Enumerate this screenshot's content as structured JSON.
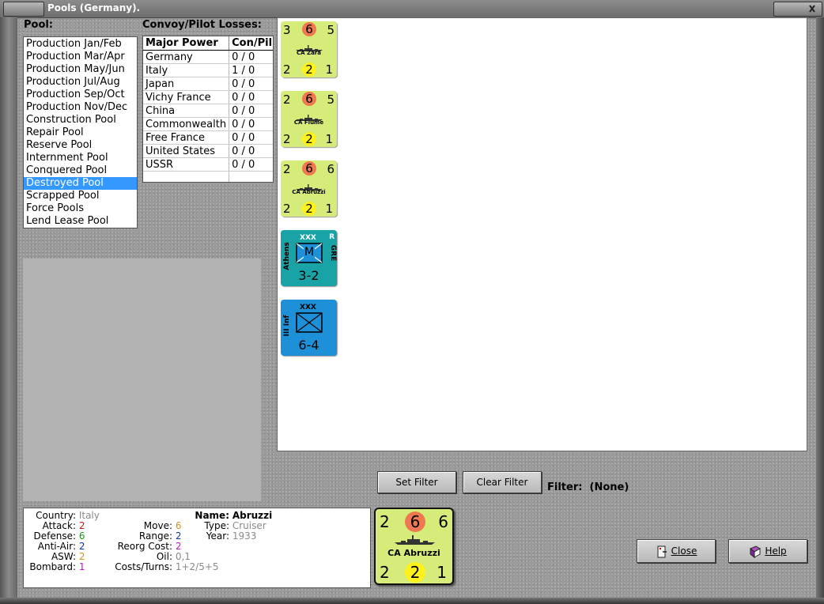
{
  "window": {
    "title": "Pools (Germany)."
  },
  "pool": {
    "heading": "Pool:",
    "items": [
      "Production Jan/Feb",
      "Production Mar/Apr",
      "Production May/Jun",
      "Production Jul/Aug",
      "Production Sep/Oct",
      "Production Nov/Dec",
      "Construction Pool",
      "Repair Pool",
      "Reserve Pool",
      "Internment Pool",
      "Conquered Pool",
      "Destroyed Pool",
      "Scrapped Pool",
      "Force Pools",
      "Lend Lease Pool"
    ],
    "selected": "Destroyed Pool"
  },
  "losses": {
    "heading": "Convoy/Pilot Losses:",
    "col_power": "Major Power",
    "col_value": "Con/Pil",
    "rows": [
      {
        "power": "Germany",
        "value": "0 / 0"
      },
      {
        "power": "Italy",
        "value": "1 / 0"
      },
      {
        "power": "Japan",
        "value": "0 / 0"
      },
      {
        "power": "Vichy France",
        "value": "0 / 0"
      },
      {
        "power": "China",
        "value": "0 / 0"
      },
      {
        "power": "Commonwealth",
        "value": "0 / 0"
      },
      {
        "power": "Free France",
        "value": "0 / 0"
      },
      {
        "power": "United States",
        "value": "0 / 0"
      },
      {
        "power": "USSR",
        "value": "0 / 0"
      }
    ]
  },
  "counters": [
    {
      "kind": "ship",
      "name": "CA Zara",
      "tl": "3",
      "tc": "6",
      "tr": "5",
      "bl": "2",
      "bc": "2",
      "br": "1"
    },
    {
      "kind": "ship",
      "name": "CA Fiume",
      "tl": "2",
      "tc": "6",
      "tr": "5",
      "bl": "2",
      "bc": "2",
      "br": "1"
    },
    {
      "kind": "ship",
      "name": "CA Abruzzi",
      "tl": "2",
      "tc": "6",
      "tr": "6",
      "bl": "2",
      "bc": "2",
      "br": "1"
    },
    {
      "kind": "land-mech",
      "side": "Athens",
      "size": "XXX",
      "corner": "R",
      "nation": "GRE",
      "symbol": "M",
      "strength": "3-2"
    },
    {
      "kind": "land-inf",
      "side": "III Inf",
      "size": "XXX",
      "strength": "6-4"
    }
  ],
  "filter": {
    "set_label": "Set Filter",
    "clear_label": "Clear Filter",
    "label": "Filter:",
    "value": "(None)"
  },
  "info": {
    "country_label": "Country:",
    "country": "Italy",
    "attack_label": "Attack:",
    "attack": "2",
    "defense_label": "Defense:",
    "defense": "6",
    "antiair_label": "Anti-Air:",
    "antiair": "2",
    "asw_label": "ASW:",
    "asw": "2",
    "bombard_label": "Bombard:",
    "bombard": "1",
    "move_label": "Move:",
    "move": "6",
    "range_label": "Range:",
    "range": "2",
    "reorg_label": "Reorg Cost:",
    "reorg": "2",
    "oil_label": "Oil:",
    "oil": "0,1",
    "costs_label": "Costs/Turns:",
    "costs": "1+2/5+5",
    "name_label": "Name:",
    "name": "Abruzzi",
    "type_label": "Type:",
    "type": "Cruiser",
    "year_label": "Year:",
    "year": "1933"
  },
  "selected_counter": {
    "name": "CA Abruzzi",
    "tl": "2",
    "tc": "6",
    "tr": "6",
    "bl": "2",
    "bc": "2",
    "br": "1"
  },
  "buttons": {
    "close": "Close",
    "help": "Help"
  },
  "colors": {
    "ship": "#d6ec7a",
    "selection": "#3399ff",
    "mech": "#1aa3a6",
    "inf": "#1d90d8"
  }
}
